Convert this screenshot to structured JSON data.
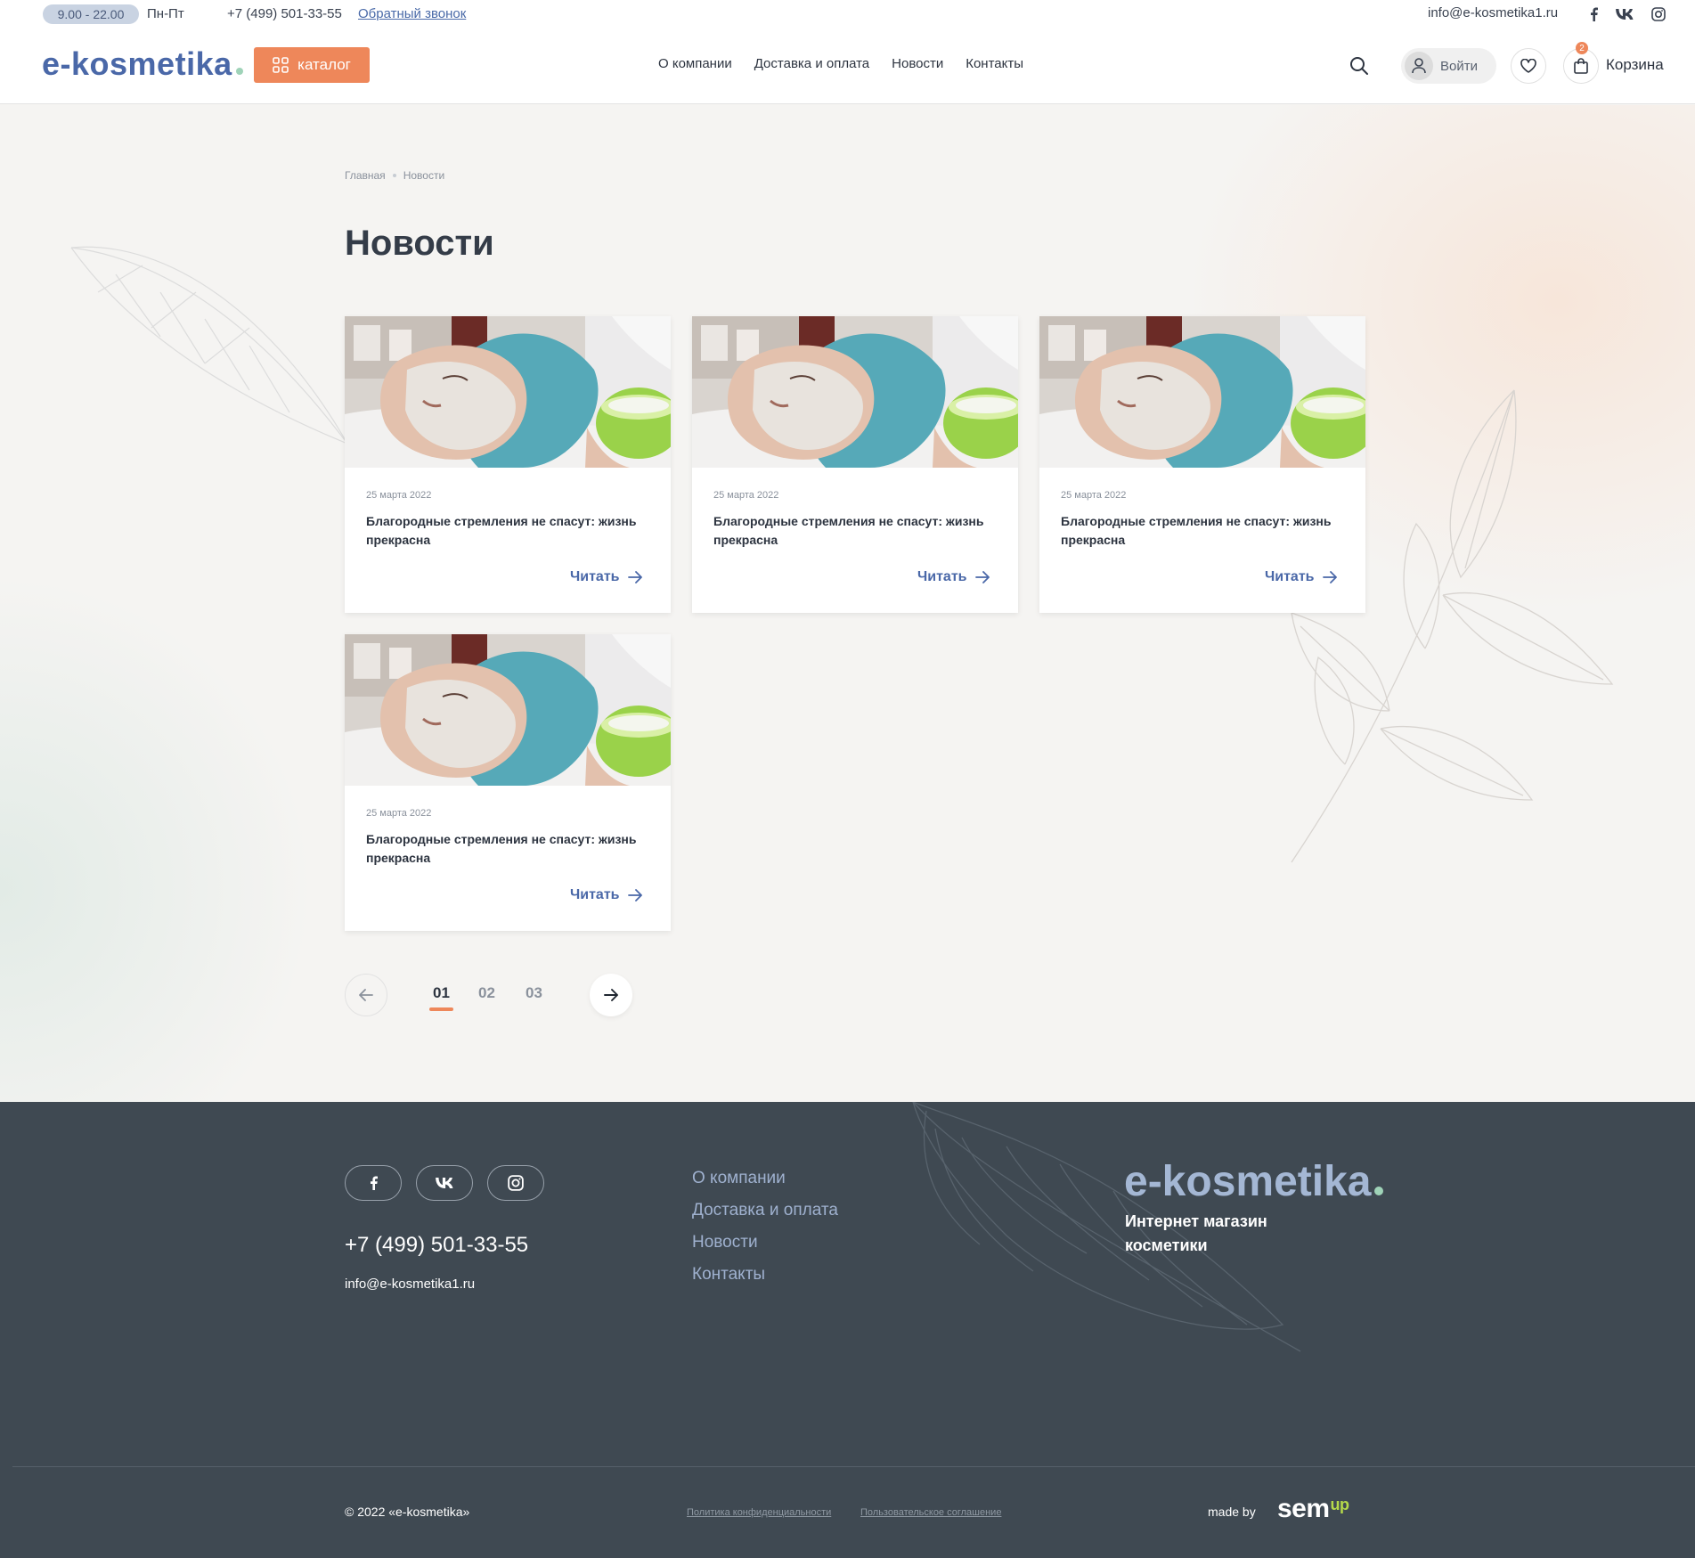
{
  "topbar": {
    "hours": "9.00 - 22.00",
    "days": "Пн-Пт",
    "phone": "+7 (499) 501-33-55",
    "callback": "Обратный звонок",
    "email": "info@e-kosmetika1.ru"
  },
  "header": {
    "logo": "e-kosmetika",
    "catalog": "каталог",
    "nav": [
      "О компании",
      "Доставка и оплата",
      "Новости",
      "Контакты"
    ],
    "login": "Войти",
    "cart_count": "2",
    "cart": "Корзина"
  },
  "breadcrumb": [
    "Главная",
    "Новости"
  ],
  "page_title": "Новости",
  "news": [
    {
      "date": "25 марта 2022",
      "title": "Благородные стремления не спасут: жизнь прекрасна",
      "read": "Читать"
    },
    {
      "date": "25 марта 2022",
      "title": "Благородные стремления не спасут: жизнь прекрасна",
      "read": "Читать"
    },
    {
      "date": "25 марта 2022",
      "title": "Благородные стремления не спасут: жизнь прекрасна",
      "read": "Читать"
    },
    {
      "date": "25 марта 2022",
      "title": "Благородные стремления не спасут: жизнь прекрасна",
      "read": "Читать"
    }
  ],
  "pagination": {
    "pages": [
      "01",
      "02",
      "03"
    ],
    "active": "01"
  },
  "footer": {
    "phone": "+7 (499) 501-33-55",
    "email": "info@e-kosmetika1.ru",
    "nav": [
      "О компании",
      "Доставка и оплата",
      "Новости",
      "Контакты"
    ],
    "logo": "e-kosmetika",
    "tagline": "Интернет магазин косметики",
    "copyright": "© 2022 «e-kosmetika»",
    "privacy": "Политика конфиденциальности",
    "agreement": "Пользовательское соглашение",
    "made_by": "made by",
    "studio_main": "sem",
    "studio_suffix": "up"
  },
  "colors": {
    "accent": "#ee875a",
    "brand": "#4a68a8",
    "footer_bg": "#3f4952"
  },
  "icons": [
    "facebook-icon",
    "vk-icon",
    "instagram-icon",
    "catalog-grid-icon",
    "search-icon",
    "user-icon",
    "heart-icon",
    "bag-icon",
    "arrow-right-icon",
    "arrow-left-icon"
  ]
}
